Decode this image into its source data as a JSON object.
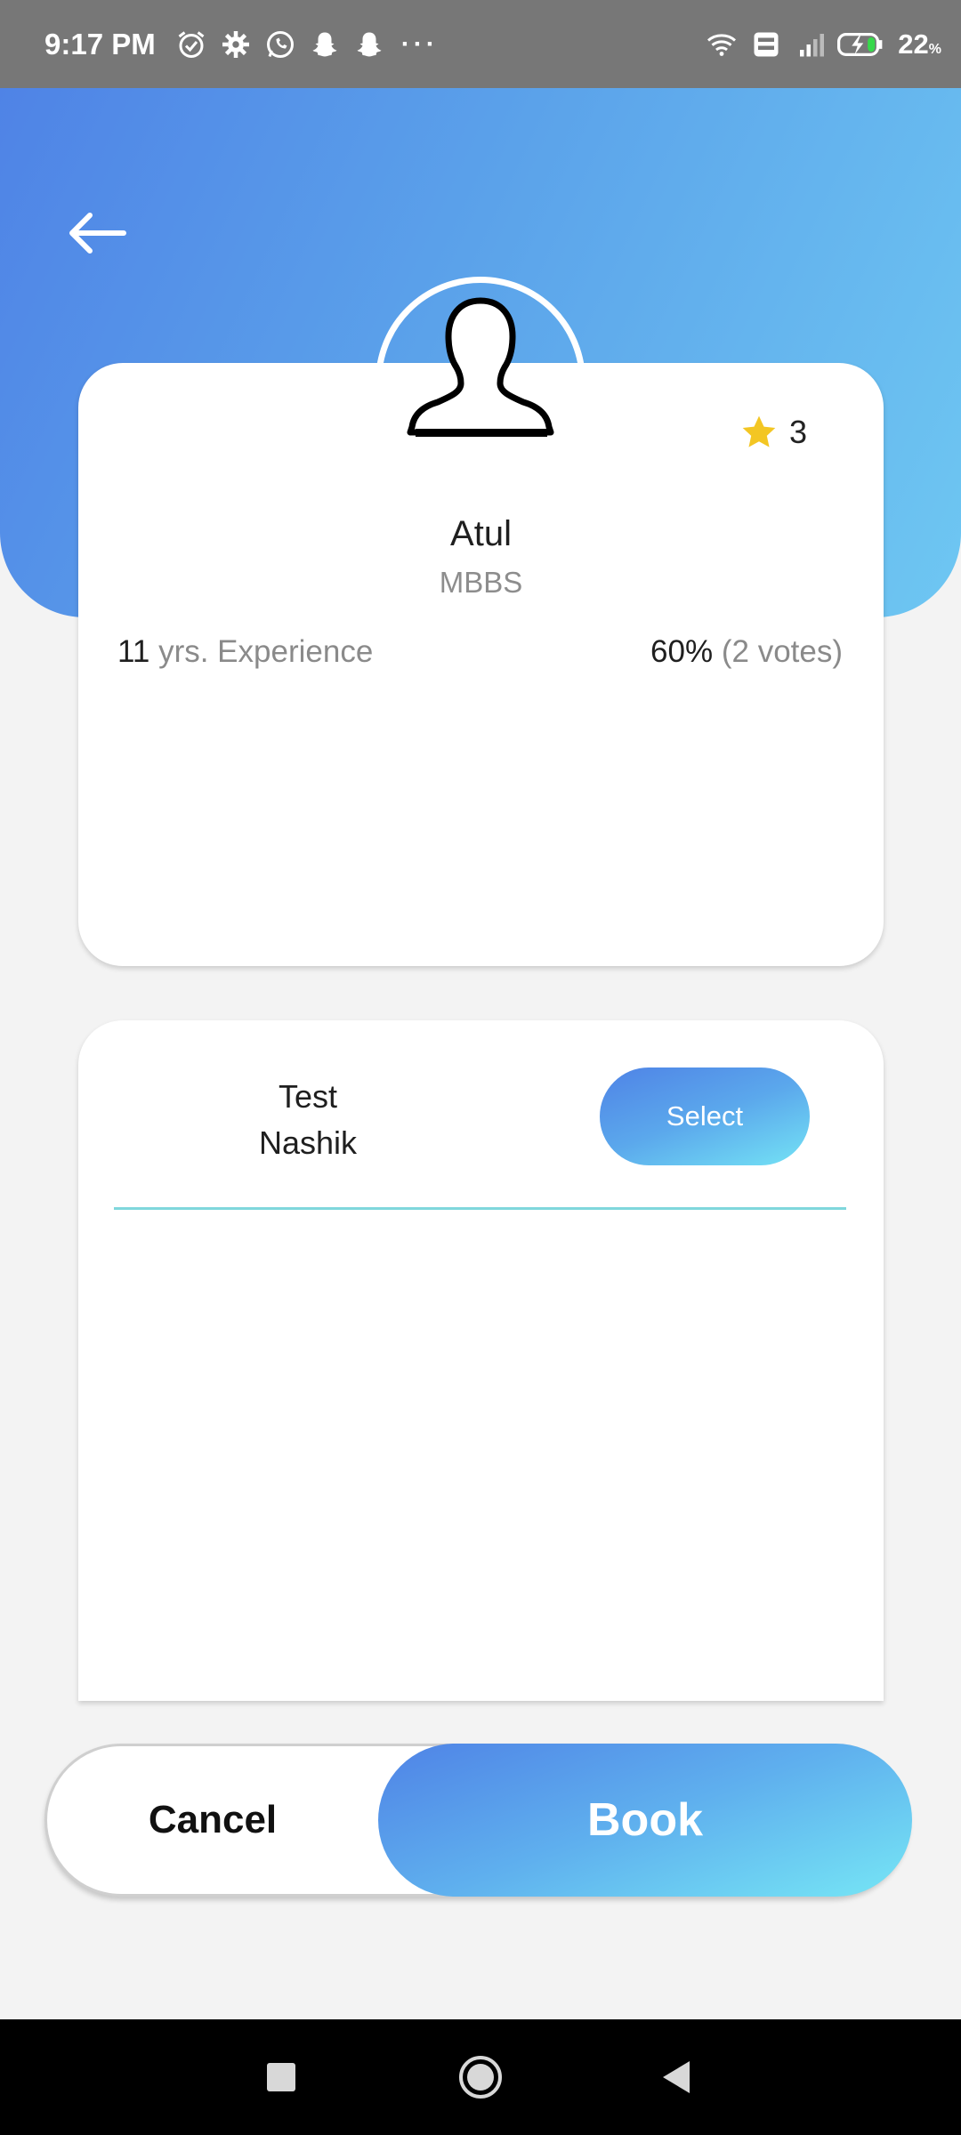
{
  "status_bar": {
    "time": "9:17 PM",
    "left_icons": [
      "alarm-icon",
      "settings-icon",
      "whatsapp-icon",
      "snapchat-icon",
      "snapchat-icon"
    ],
    "more": "···",
    "right_icons": [
      "wifi-icon",
      "volte-icon",
      "signal-icon",
      "battery-charging-icon"
    ],
    "battery_value": "22",
    "battery_unit": "%"
  },
  "header": {
    "back_icon": "back-arrow-icon"
  },
  "doctor": {
    "name": "Atul",
    "degree": "MBBS",
    "rating": "3",
    "experience_years": "11",
    "experience_label": "yrs. Experience",
    "vote_percent": "60%",
    "vote_count": "(2 votes)"
  },
  "clinic": {
    "name": "Test",
    "city": "Nashik",
    "select_label": "Select"
  },
  "actions": {
    "cancel_label": "Cancel",
    "book_label": "Book"
  },
  "nav": [
    "recents-icon",
    "home-icon",
    "back-icon"
  ],
  "colors": {
    "header_gradient_start": "#4f83e6",
    "header_gradient_end": "#6ec7f2",
    "accent_cyan": "#76e6f5",
    "divider": "#7fd7dc",
    "star": "#f3c623",
    "status_bar": "#777777"
  }
}
